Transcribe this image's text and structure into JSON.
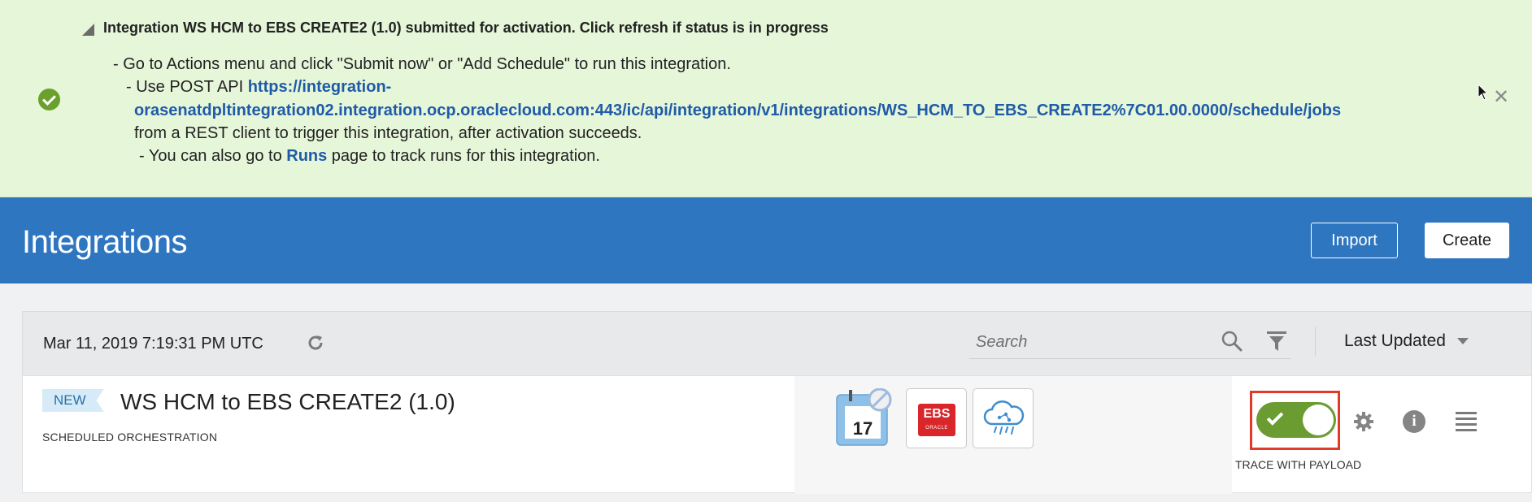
{
  "banner": {
    "heading": "Integration WS HCM to EBS CREATE2 (1.0) submitted for activation. Click refresh if status is in progress",
    "line1": "- Go to Actions menu and click \"Submit now\" or \"Add Schedule\" to run this integration.",
    "line2_prefix": "- Use POST API ",
    "api_url_part1": "https://integration-",
    "api_url_part2": "orasenatdpltintegration02.integration.ocp.oraclecloud.com:443/ic/api/integration/v1/integrations/WS_HCM_TO_EBS_CREATE2%7C01.00.0000/schedule/jobs",
    "line3": "from a REST client to trigger this integration, after activation succeeds.",
    "line4_prefix": "- You can also go to ",
    "runs_link": "Runs",
    "line4_suffix": " page to track runs for this integration.",
    "close_glyph": "✕",
    "status_icon": "check-circle-icon"
  },
  "header": {
    "title": "Integrations",
    "import_label": "Import",
    "create_label": "Create"
  },
  "toolbar": {
    "last_refreshed": "Mar 11, 2019 7:19:31 PM UTC",
    "search_placeholder": "Search",
    "sort_label": "Last Updated"
  },
  "integration": {
    "badge": "NEW",
    "name": "WS HCM to EBS CREATE2  (1.0)",
    "type": "SCHEDULED ORCHESTRATION",
    "calendar_day": "17",
    "ebs_label": "EBS",
    "ebs_sub": "ORACLE",
    "trace_label": "TRACE WITH PAYLOAD",
    "activated": true
  },
  "colors": {
    "banner_bg": "#e6f6d9",
    "header_bg": "#2f76c1",
    "toggle_on": "#6a9c31",
    "highlight": "#e13a2b",
    "link": "#1f5ba8"
  }
}
